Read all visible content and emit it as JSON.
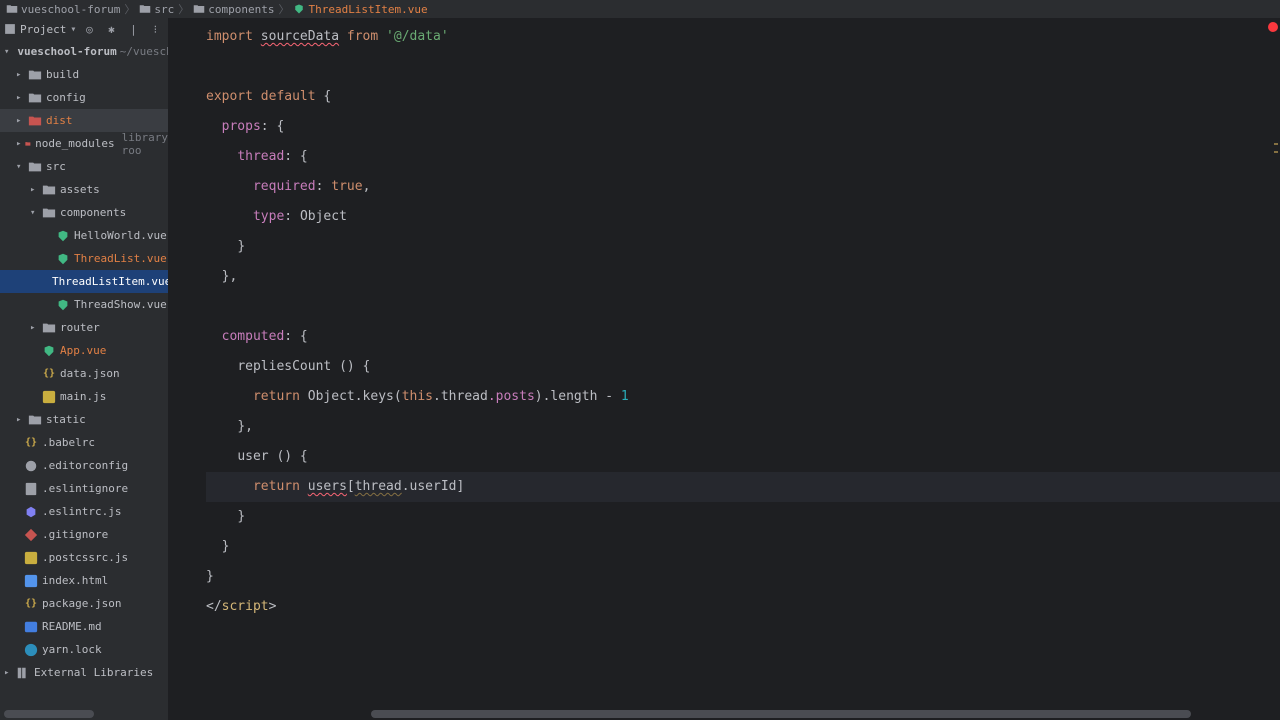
{
  "breadcrumb": {
    "root": "vueschool-forum",
    "src": "src",
    "components": "components",
    "file": "ThreadListItem.vue"
  },
  "sidebar": {
    "headerLabel": "Project",
    "tree": {
      "root": "vueschool-forum",
      "rootHint": "~/vuesch",
      "build": "build",
      "config": "config",
      "dist": "dist",
      "node_modules": "node_modules",
      "node_modules_hint": "library roo",
      "src": "src",
      "assets": "assets",
      "components": "components",
      "helloWorld": "HelloWorld.vue",
      "threadList": "ThreadList.vue",
      "threadListItem": "ThreadListItem.vue",
      "threadShow": "ThreadShow.vue",
      "router": "router",
      "appVue": "App.vue",
      "dataJson": "data.json",
      "mainJs": "main.js",
      "static": "static",
      "babelrc": ".babelrc",
      "editorconfig": ".editorconfig",
      "eslintignore": ".eslintignore",
      "eslintrc": ".eslintrc.js",
      "gitignore": ".gitignore",
      "postcssrc": ".postcssrc.js",
      "indexHtml": "index.html",
      "packageJson": "package.json",
      "readme": "README.md",
      "yarnLock": "yarn.lock",
      "externalLibs": "External Libraries"
    }
  },
  "code": {
    "l1_import": "import",
    "l1_sourceData": "sourceData",
    "l1_from": "from",
    "l1_path": "'@/data'",
    "l3_export": "export",
    "l3_default": "default",
    "l4_props": "props",
    "l5_thread": "thread",
    "l6_required": "required",
    "l6_true": "true",
    "l7_type": "type",
    "l7_object": "Object",
    "l11_computed": "computed",
    "l12_repliesCount": "repliesCount",
    "l13_return": "return",
    "l13_object": "Object",
    "l13_keys": ".keys(",
    "l13_this": "this",
    "l13_thread": ".thread",
    "l13_posts": ".posts",
    "l13_length": ").length - ",
    "l13_one": "1",
    "l15_user": "user",
    "l16_return": "return",
    "l16_users": "users",
    "l16_thread": "thread",
    "l16_userId": ".userId]",
    "l20_script": "script"
  }
}
